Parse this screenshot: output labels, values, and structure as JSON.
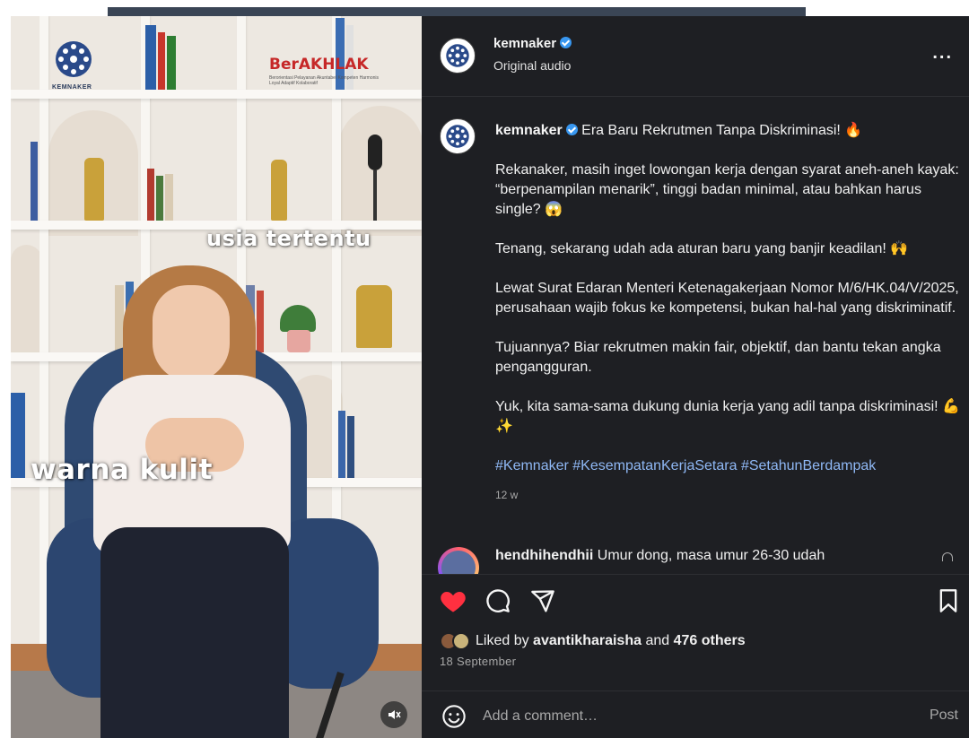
{
  "video": {
    "caption_top": "usia tertentu",
    "caption_bottom": "warna kulit",
    "logo_text": "KEMNAKER",
    "banner_text": "BerAKHLAK",
    "banner_subtext": "Berorientasi Pelayanan Akuntabel Kompeten Harmonis Loyal Adaptif Kolaboratif",
    "mute_icon": "muted-speaker-icon"
  },
  "header": {
    "username": "kemnaker",
    "subtitle": "Original audio",
    "more_label": "..."
  },
  "caption": {
    "username": "kemnaker",
    "title": "Era Baru Rekrutmen Tanpa Diskriminasi! 🔥",
    "paragraphs": [
      "Rekanaker, masih inget lowongan kerja dengan syarat aneh-aneh kayak: “berpenampilan menarik”, tinggi badan minimal, atau bahkan harus single? 😱",
      "Tenang, sekarang udah ada aturan baru yang banjir keadilan! 🙌",
      "Lewat Surat Edaran Menteri Ketenagakerjaan Nomor M/6/HK.04/V/2025, perusahaan wajib fokus ke kompetensi, bukan hal-hal yang diskriminatif.",
      "Tujuannya? Biar rekrutmen makin fair, objektif, dan bantu tekan angka pengangguran.",
      "Yuk, kita sama-sama dukung dunia kerja yang adil tanpa diskriminasi! 💪✨"
    ],
    "hashtags": "#Kemnaker #KesempatanKerjaSetara #SetahunBerdampak",
    "age": "12 w"
  },
  "comment": {
    "username": "hendhihendhii",
    "text": "Umur dong, masa umur 26-30 udah"
  },
  "actions": {
    "like_icon": "heart-filled-icon",
    "comment_icon": "comment-bubble-icon",
    "share_icon": "paper-plane-icon",
    "save_icon": "bookmark-icon",
    "like_color": "#ff3040"
  },
  "likes": {
    "prefix": "Liked by",
    "user": "avantikharaisha",
    "connector": "and",
    "others": "476 others"
  },
  "date": "18 September",
  "composer": {
    "placeholder": "Add a comment…",
    "post_label": "Post"
  },
  "colors": {
    "panel_bg": "#1e1f23",
    "verified": "#3897f0",
    "hashtag": "#8fb8f5"
  }
}
